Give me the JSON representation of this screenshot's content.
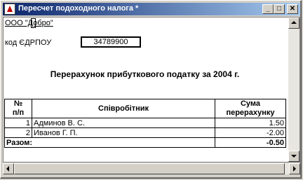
{
  "window": {
    "title": "Пересчет подоходного налога  *",
    "min_glyph": "_",
    "max_glyph": "□",
    "close_glyph": "✕"
  },
  "report": {
    "company": "ООО \"Добро\"",
    "code_label": "код ЄДРПОУ",
    "code_value": "34789900",
    "title": "Перерахунок прибуткового податку за 2004 г."
  },
  "table": {
    "columns": [
      "№\nп/п",
      "Співробітник",
      "Сума\nперерахунку"
    ],
    "col_no_line1": "№",
    "col_no_line2": "п/п",
    "col_employee": "Співробітник",
    "col_sum_line1": "Сума",
    "col_sum_line2": "перерахунку",
    "rows": [
      {
        "no": "1",
        "employee": "Админов В. С.",
        "sum": "1.50"
      },
      {
        "no": "2",
        "employee": "Иванов Г. П.",
        "sum": "-2.00"
      }
    ],
    "total_label": "Разом:",
    "total_value": "-0.50"
  }
}
